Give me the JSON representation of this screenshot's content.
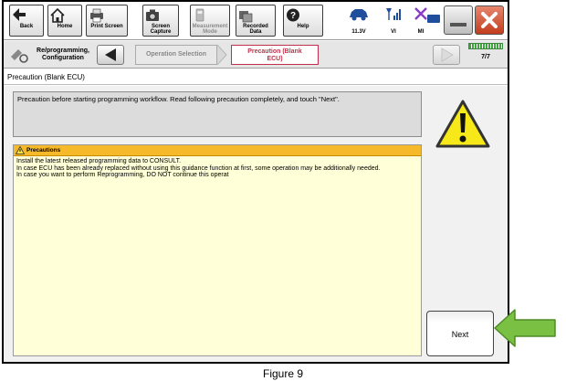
{
  "toolbar": {
    "buttons": [
      {
        "label": "Back",
        "icon": "back-arrow-icon"
      },
      {
        "label": "Home",
        "icon": "home-icon"
      },
      {
        "label": "Print Screen",
        "icon": "printer-icon"
      },
      {
        "label": "Screen\nCapture",
        "icon": "camera-icon"
      },
      {
        "label": "Measurement\nMode",
        "icon": "measurement-icon"
      },
      {
        "label": "Recorded\nData",
        "icon": "recorded-data-icon"
      },
      {
        "label": "Help",
        "icon": "help-icon"
      }
    ],
    "status": [
      {
        "label": "11.3V",
        "icon": "car-battery-icon"
      },
      {
        "label": "VI",
        "icon": "signal-icon"
      },
      {
        "label": "MI",
        "icon": "disconnected-icon"
      }
    ]
  },
  "breadcrumb": {
    "step1": "Re/programming,\nConfiguration",
    "step2": "Operation Selection",
    "step3": "Precaution (Blank\nECU)",
    "page": "7/7"
  },
  "page_title": "Precaution (Blank ECU)",
  "instruction": "Precaution before starting programming workflow. Read following precaution completely, and touch \"Next\".",
  "precautions": {
    "title": "Precautions",
    "body": "Install the latest released programming data to CONSULT.\nIn case ECU has been already replaced without using this guidance function at first, some operation may be additionally needed.\nIn case you want to perform Reprogramming, DO NOT continue this operat"
  },
  "next_label": "Next",
  "caption": "Figure 9",
  "colors": {
    "accent": "#c0324a",
    "precaution_header": "#f6b92a",
    "pointer_arrow": "#7ac143"
  }
}
